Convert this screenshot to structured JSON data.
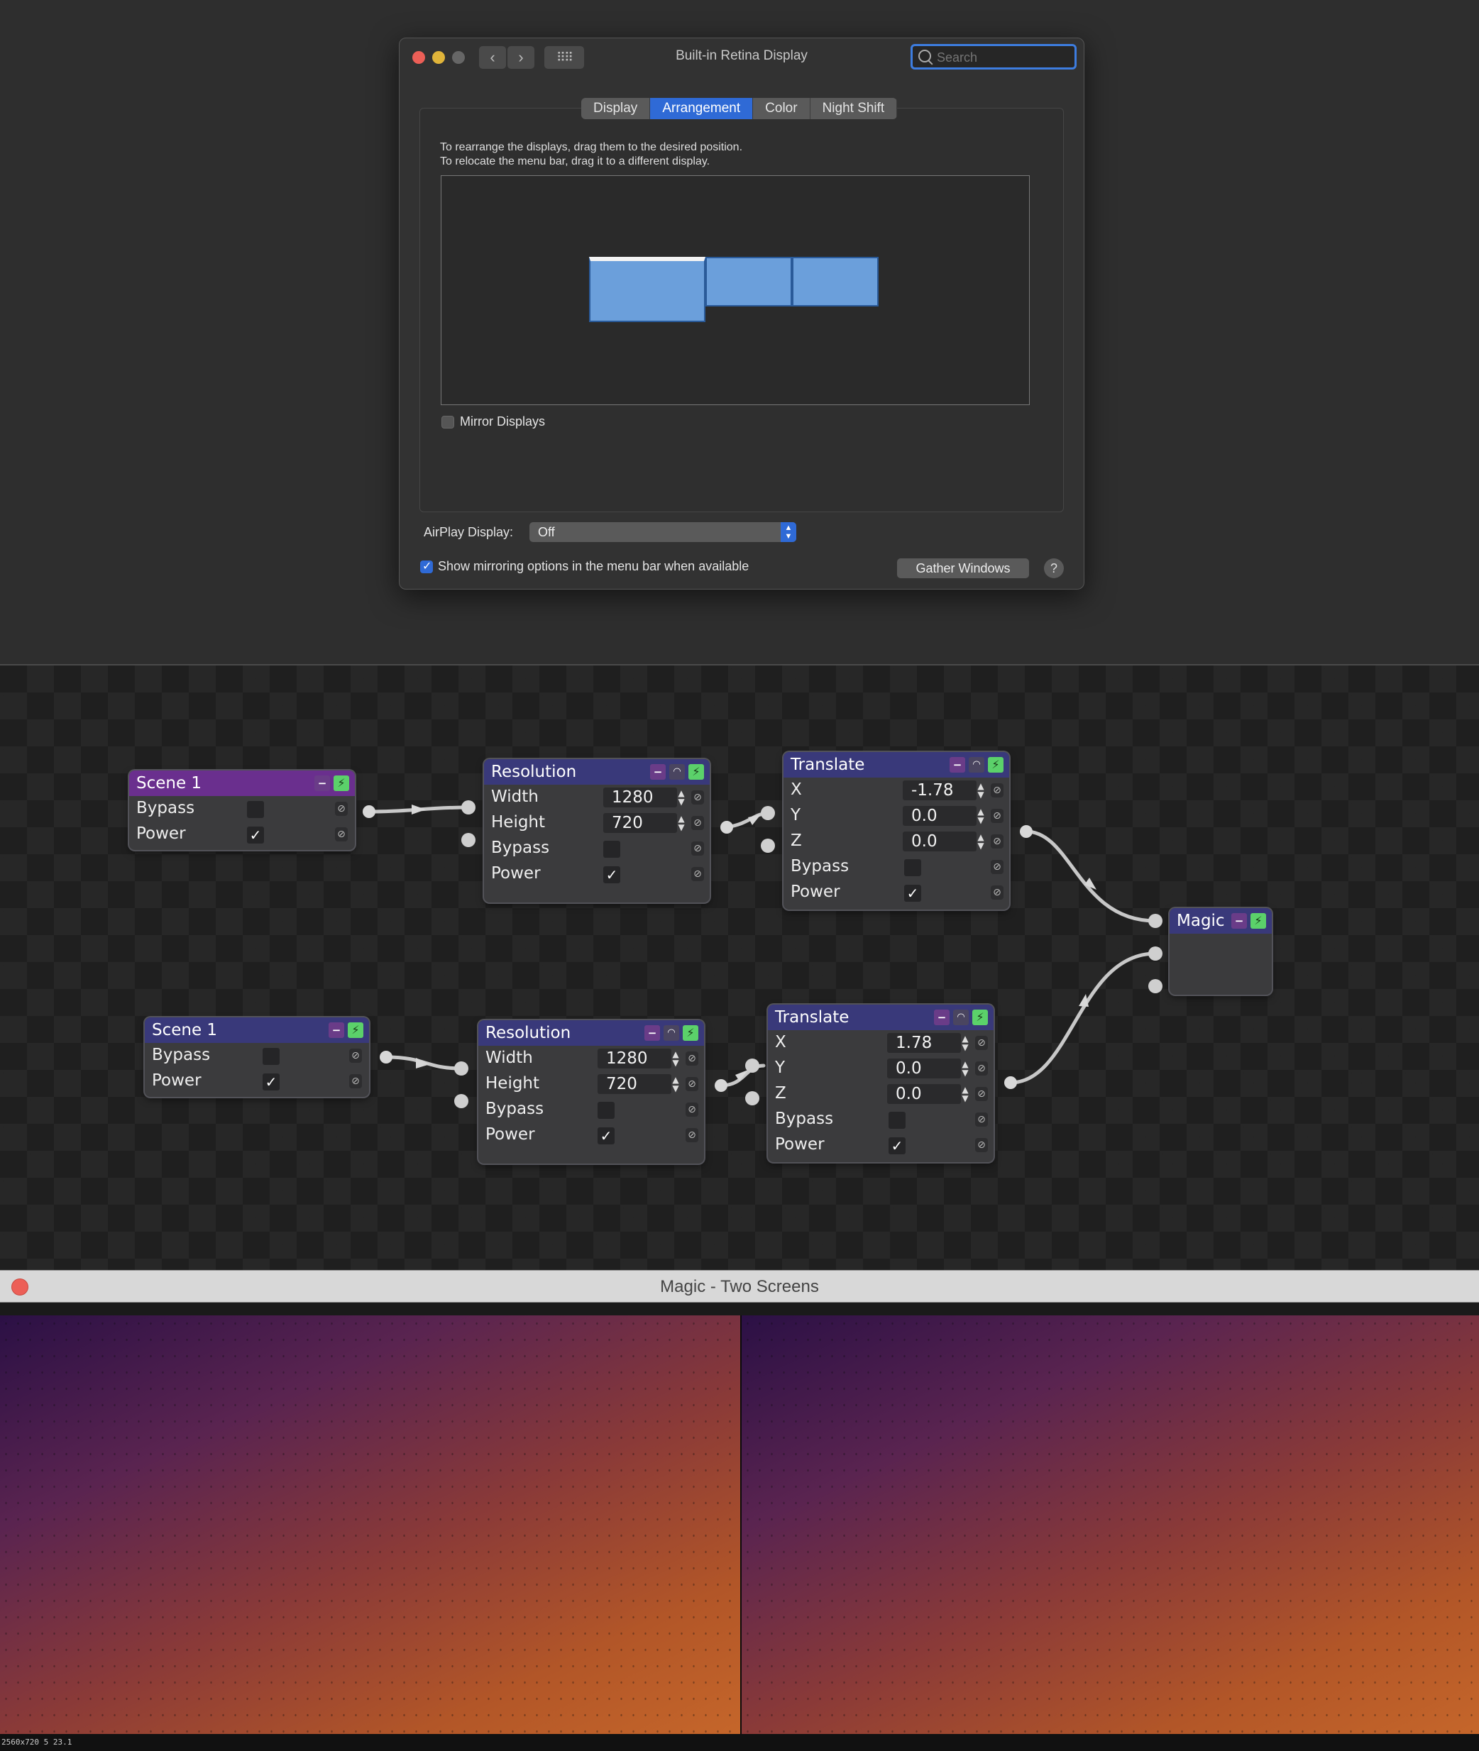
{
  "prefs": {
    "title": "Built-in Retina Display",
    "search_placeholder": "Search",
    "nav": {
      "back": "‹",
      "forward": "›",
      "grid": "⠿⠿"
    },
    "tabs": [
      {
        "label": "Display",
        "active": false
      },
      {
        "label": "Arrangement",
        "active": true
      },
      {
        "label": "Color",
        "active": false
      },
      {
        "label": "Night Shift",
        "active": false
      }
    ],
    "instructions": [
      "To rearrange the displays, drag them to the desired position.",
      "To relocate the menu bar, drag it to a different display."
    ],
    "mirror_displays": {
      "label": "Mirror Displays",
      "checked": false
    },
    "airplay": {
      "label": "AirPlay Display:",
      "value": "Off"
    },
    "show_mirroring": {
      "label": "Show mirroring options in the menu bar when available",
      "checked": true
    },
    "gather_button": "Gather Windows",
    "help_button": "?"
  },
  "nodes": {
    "scene_top": {
      "title": "Scene 1",
      "bypass": {
        "label": "Bypass",
        "checked": false
      },
      "power": {
        "label": "Power",
        "checked": true
      }
    },
    "res_top": {
      "title": "Resolution",
      "width": {
        "label": "Width",
        "value": "1280"
      },
      "height": {
        "label": "Height",
        "value": "720"
      },
      "bypass": {
        "label": "Bypass",
        "checked": false
      },
      "power": {
        "label": "Power",
        "checked": true
      }
    },
    "trans_top": {
      "title": "Translate",
      "x": {
        "label": "X",
        "value": "-1.78"
      },
      "y": {
        "label": "Y",
        "value": "0.0"
      },
      "z": {
        "label": "Z",
        "value": "0.0"
      },
      "bypass": {
        "label": "Bypass",
        "checked": false
      },
      "power": {
        "label": "Power",
        "checked": true
      }
    },
    "magic": {
      "title": "Magic"
    },
    "scene_bot": {
      "title": "Scene 1",
      "bypass": {
        "label": "Bypass",
        "checked": false
      },
      "power": {
        "label": "Power",
        "checked": true
      }
    },
    "res_bot": {
      "title": "Resolution",
      "width": {
        "label": "Width",
        "value": "1280"
      },
      "height": {
        "label": "Height",
        "value": "720"
      },
      "bypass": {
        "label": "Bypass",
        "checked": false
      },
      "power": {
        "label": "Power",
        "checked": true
      }
    },
    "trans_bot": {
      "title": "Translate",
      "x": {
        "label": "X",
        "value": "1.78"
      },
      "y": {
        "label": "Y",
        "value": "0.0"
      },
      "z": {
        "label": "Z",
        "value": "0.0"
      },
      "bypass": {
        "label": "Bypass",
        "checked": false
      },
      "power": {
        "label": "Power",
        "checked": true
      }
    }
  },
  "icons": {
    "minimize": "−",
    "eye": "◠",
    "power": "⚡",
    "link": "⊘",
    "check": "✓",
    "stepper": "▲▼"
  },
  "output": {
    "title": "Magic - Two Screens",
    "status": "2560x720  5  23.1"
  },
  "colors": {
    "accent": "#2f6ad6",
    "node_header": "#39397a",
    "scene_header_active": "#6a2f8e",
    "power_icon": "#5bd16a",
    "close_red": "#ec5f57"
  }
}
